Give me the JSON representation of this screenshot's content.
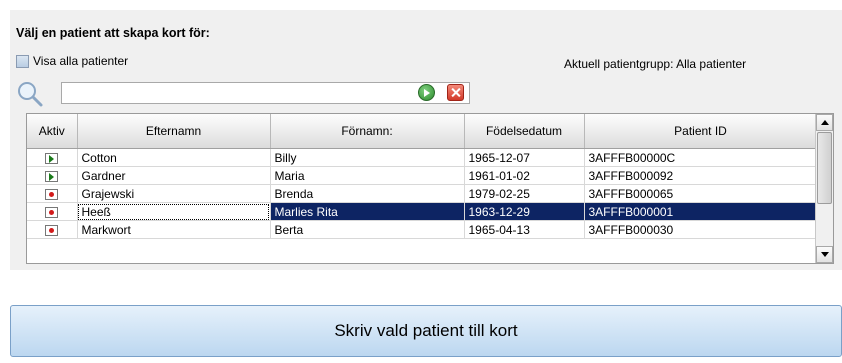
{
  "title": "Välj en patient att skapa kort för:",
  "show_all_label": "Visa alla patienter",
  "current_group_label": "Aktuell patientgrupp: Alla patienter",
  "search": {
    "value": "",
    "placeholder": ""
  },
  "table": {
    "columns": [
      "Aktiv",
      "Efternamn",
      "Förnamn:",
      "Födelsedatum",
      "Patient ID"
    ],
    "rows": [
      {
        "status": "arrow",
        "lastname": "Cotton",
        "firstname": "Billy",
        "birthdate": "1965-12-07",
        "patient_id": "3AFFFB00000C",
        "selected": false
      },
      {
        "status": "arrow",
        "lastname": "Gardner",
        "firstname": "Maria",
        "birthdate": "1961-01-02",
        "patient_id": "3AFFFB000092",
        "selected": false
      },
      {
        "status": "dot",
        "lastname": "Grajewski",
        "firstname": "Brenda",
        "birthdate": "1979-02-25",
        "patient_id": "3AFFFB000065",
        "selected": false
      },
      {
        "status": "dot",
        "lastname": "Heeß",
        "firstname": "Marlies Rita",
        "birthdate": "1963-12-29",
        "patient_id": "3AFFFB000001",
        "selected": true
      },
      {
        "status": "dot",
        "lastname": "Markwort",
        "firstname": "Berta",
        "birthdate": "1965-04-13",
        "patient_id": "3AFFFB000030",
        "selected": false
      }
    ]
  },
  "write_button_label": "Skriv vald patient till kort",
  "colors": {
    "selection": "#0d2463",
    "button_bg": "#bcd7f0",
    "panel_bg": "#f0f0f0"
  }
}
